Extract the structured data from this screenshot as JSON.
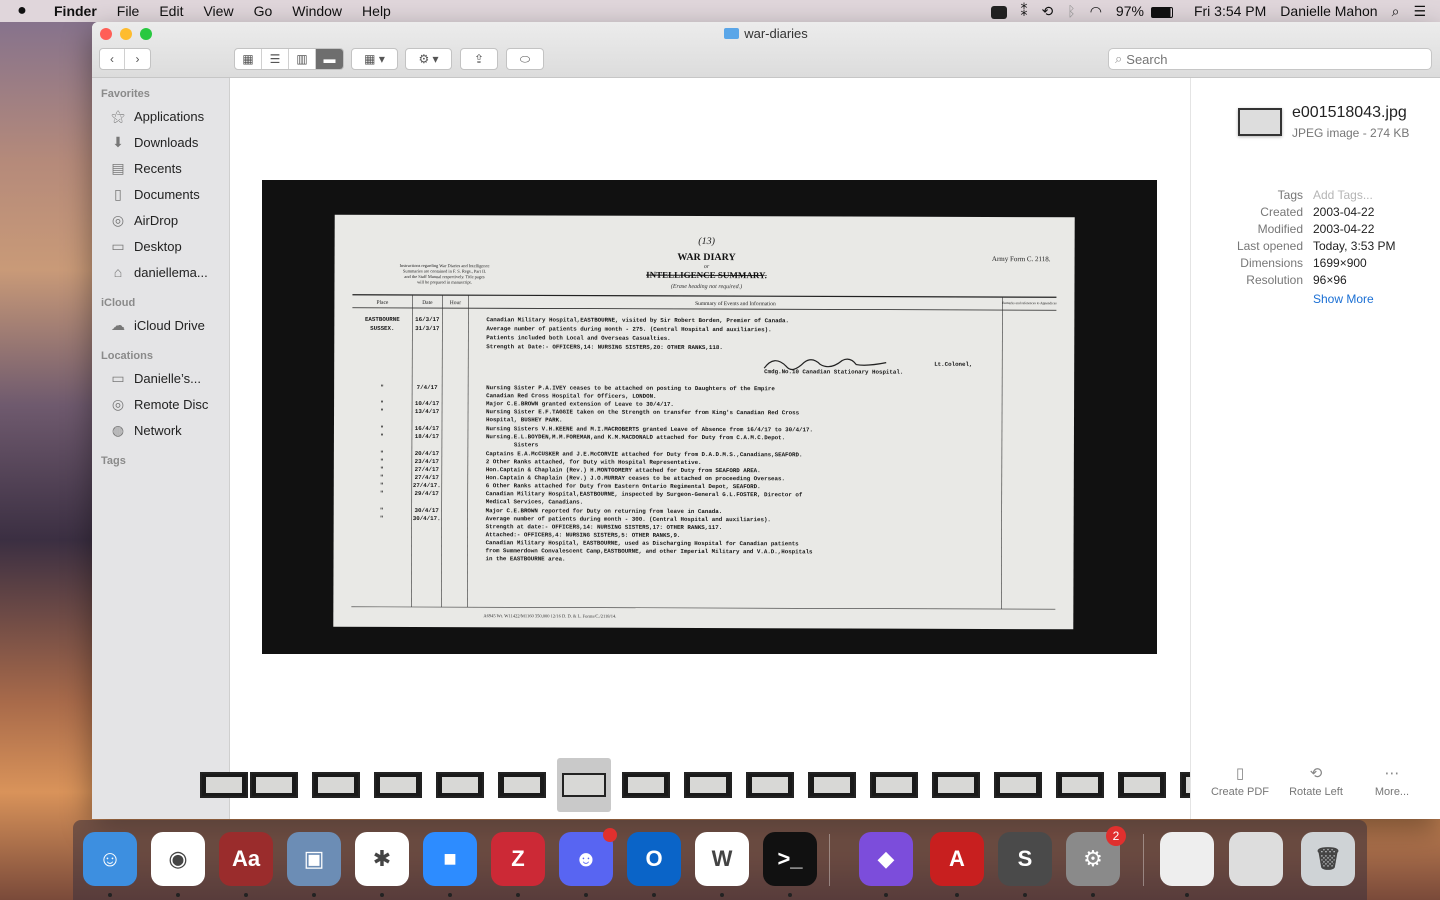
{
  "menubar": {
    "app": "Finder",
    "items": [
      "File",
      "Edit",
      "View",
      "Go",
      "Window",
      "Help"
    ],
    "battery": "97%",
    "clock": "Fri 3:54 PM",
    "user": "Danielle Mahon"
  },
  "window": {
    "title": "war-diaries",
    "search_placeholder": "Search"
  },
  "sidebar": {
    "favorites_header": "Favorites",
    "favorites": [
      {
        "label": "Applications",
        "icon": "applications-icon"
      },
      {
        "label": "Downloads",
        "icon": "downloads-icon"
      },
      {
        "label": "Recents",
        "icon": "recents-icon"
      },
      {
        "label": "Documents",
        "icon": "documents-icon"
      },
      {
        "label": "AirDrop",
        "icon": "airdrop-icon"
      },
      {
        "label": "Desktop",
        "icon": "desktop-icon"
      },
      {
        "label": "daniellema...",
        "icon": "home-icon"
      }
    ],
    "icloud_header": "iCloud",
    "icloud": [
      {
        "label": "iCloud Drive",
        "icon": "cloud-icon"
      }
    ],
    "locations_header": "Locations",
    "locations": [
      {
        "label": "Danielle’s...",
        "icon": "laptop-icon"
      },
      {
        "label": "Remote Disc",
        "icon": "disc-icon"
      },
      {
        "label": "Network",
        "icon": "network-icon"
      }
    ],
    "tags_header": "Tags"
  },
  "document": {
    "page_number": "(13)",
    "title": "WAR DIARY",
    "or": "or",
    "subtitle": "INTELLIGENCE SUMMARY.",
    "erase_note": "(Erase heading not required.)",
    "army_form": "Army Form C. 2118.",
    "instructions": [
      "Instructions regarding War Diaries and Intelligence",
      "Summaries are contained in F. S. Regs., Part II.",
      "and the Staff Manual respectively. Title pages",
      "will be prepared in manuscript."
    ],
    "columns": [
      "Place",
      "Date",
      "Hour",
      "Summary of Events and Information",
      "Remarks and references to Appendices"
    ],
    "lines": [
      {
        "place": "EASTBOURNE",
        "date": "16/3/17",
        "text": "Canadian Military Hospital,EASTBOURNE, visited by Sir Robert Borden, Premier of Canada."
      },
      {
        "place": "SUSSEX.",
        "date": "31/3/17",
        "text": "Average number of patients during month - 275. (Central Hospital and auxiliaries)."
      },
      {
        "place": "",
        "date": "",
        "text": "Patients included both Local and Overseas Casualties."
      },
      {
        "place": "",
        "date": "",
        "text": "Strength at Date:- OFFICERS,14: NURSING SISTERS,20: OTHER RANKS,118."
      },
      {
        "place": "",
        "date": "",
        "text": "Lt.Colonel,"
      },
      {
        "place": "",
        "date": "",
        "text": "Cmdg.No.10 Canadian Stationary Hospital."
      },
      {
        "place": "\"",
        "date": "7/4/17",
        "text": "Nursing Sister P.A.IVEY ceases to be attached on posting to Daughters of the Empire"
      },
      {
        "place": "",
        "date": "",
        "text": "Canadian Red Cross Hospital for Officers, LONDON."
      },
      {
        "place": "\"",
        "date": "10/4/17",
        "text": "Major C.E.BROWN granted extension of Leave to 30/4/17."
      },
      {
        "place": "\"",
        "date": "13/4/17",
        "text": "Nursing Sister E.F.TAGGIE taken on the Strength on transfer from King's Canadian Red Cross"
      },
      {
        "place": "",
        "date": "",
        "text": "Hospital, BUSHEY PARK."
      },
      {
        "place": "\"",
        "date": "16/4/17",
        "text": "Nursing Sisters V.H.KEENE and M.I.MACROBERTS granted Leave of Absence from 16/4/17 to 30/4/17."
      },
      {
        "place": "\"",
        "date": "18/4/17",
        "text": "Nursing.E.L.BOYDEN,M.M.FOREMAN,and K.M.MACDONALD attached for Duty from C.A.M.C.Depot."
      },
      {
        "place": "",
        "date": "",
        "text": "Sisters"
      },
      {
        "place": "\"",
        "date": "20/4/17",
        "text": "Captains E.A.McCUSKER and J.E.McCORVIE attached for Duty from D.A.D.M.S.,Canadians,SEAFORD."
      },
      {
        "place": "\"",
        "date": "23/4/17",
        "text": "2 Other Ranks attached, for Duty with Hospital Representative."
      },
      {
        "place": "\"",
        "date": "27/4/17",
        "text": "Hon.Captain & Chaplain (Rev.) H.MONTGOMERY attached for Duty from SEAFORD AREA."
      },
      {
        "place": "\"",
        "date": "27/4/17",
        "text": "Hon.Captain & Chaplain (Rev.) J.O.MURRAY ceases to be attached on proceeding Overseas."
      },
      {
        "place": "\"",
        "date": "27/4/17.",
        "text": "6 Other Ranks attached for Duty from Eastern Ontario Regimental Depot, SEAFORD."
      },
      {
        "place": "\"",
        "date": "29/4/17",
        "text": "Canadian Military Hospital,EASTBOURNE, inspected by Surgeon-General G.L.FOSTER, Director of"
      },
      {
        "place": "",
        "date": "",
        "text": "Medical Services, Canadians."
      },
      {
        "place": "\"",
        "date": "30/4/17",
        "text": "Major C.E.BROWN reported for Duty on returning from leave in Canada."
      },
      {
        "place": "\"",
        "date": "30/4/17.",
        "text": "Average number of patients during month - 300. (Central Hospital and auxiliaries)."
      },
      {
        "place": "",
        "date": "",
        "text": "Strength at date:- OFFICERS,14: NURSING SISTERS,17: OTHER RANKS,117."
      },
      {
        "place": "",
        "date": "",
        "text": "Attached:- OFFICERS,4: NURSING SISTERS,5: OTHER RANKS,9."
      },
      {
        "place": "",
        "date": "",
        "text": "Canadian Military Hospital, EASTBOURNE, used as Discharging Hospital for Canadian patients"
      },
      {
        "place": "",
        "date": "",
        "text": "from Summerdown Convalescent Camp,EASTBOURNE, and other Imperial Military and V.A.D.,Hospitals"
      },
      {
        "place": "",
        "date": "",
        "text": "in the EASTBOURNE area."
      }
    ],
    "footer": "A6945 Wt. W11422/M1160 350,000 12/16 D. D. & L. Forms/C./2118/14."
  },
  "info": {
    "filename": "e001518043.jpg",
    "kind": "JPEG image - 274 KB",
    "rows": [
      {
        "k": "Tags",
        "v": "Add Tags..."
      },
      {
        "k": "Created",
        "v": "2003-04-22"
      },
      {
        "k": "Modified",
        "v": "2003-04-22"
      },
      {
        "k": "Last opened",
        "v": "Today, 3:53 PM"
      },
      {
        "k": "Dimensions",
        "v": "1699×900"
      },
      {
        "k": "Resolution",
        "v": "96×96"
      }
    ],
    "show_more": "Show More",
    "actions": [
      {
        "label": "Create PDF",
        "icon": "pdf-icon"
      },
      {
        "label": "Rotate Left",
        "icon": "rotate-left-icon"
      },
      {
        "label": "More...",
        "icon": "more-icon"
      }
    ]
  },
  "dock": {
    "apps": [
      {
        "name": "Finder",
        "color": "#3d8fe0",
        "glyph": "☺"
      },
      {
        "name": "Chrome",
        "color": "#ffffff",
        "glyph": "◉"
      },
      {
        "name": "Dictionary",
        "color": "#9a2c2c",
        "glyph": "Aa"
      },
      {
        "name": "Preview",
        "color": "#6c8db5",
        "glyph": "▣"
      },
      {
        "name": "Slack",
        "color": "#ffffff",
        "glyph": "✱"
      },
      {
        "name": "Zoom",
        "color": "#2d8cff",
        "glyph": "■"
      },
      {
        "name": "Zotero",
        "color": "#cc2936",
        "glyph": "Z"
      },
      {
        "name": "Discord",
        "color": "#5865f2",
        "glyph": "☻"
      },
      {
        "name": "Outlook",
        "color": "#0a64c8",
        "glyph": "O"
      },
      {
        "name": "Word",
        "color": "#ffffff",
        "glyph": "W"
      },
      {
        "name": "Terminal",
        "color": "#111111",
        "glyph": ">_"
      },
      {
        "name": "Obsidian",
        "color": "#7c4ddb",
        "glyph": "◆"
      },
      {
        "name": "Acrobat",
        "color": "#c81f1f",
        "glyph": "A"
      },
      {
        "name": "Sublime Text",
        "color": "#4a4a4a",
        "glyph": "S"
      },
      {
        "name": "System Preferences",
        "color": "#8a8a8a",
        "glyph": "⚙"
      },
      {
        "name": "Screenshot 1",
        "color": "#eeeeee",
        "glyph": ""
      },
      {
        "name": "Screenshot 2",
        "color": "#dddddd",
        "glyph": ""
      },
      {
        "name": "Trash",
        "color": "#cfd3d6",
        "glyph": "🗑"
      }
    ],
    "discord_badge": "",
    "sysprefs_badge": "2"
  }
}
